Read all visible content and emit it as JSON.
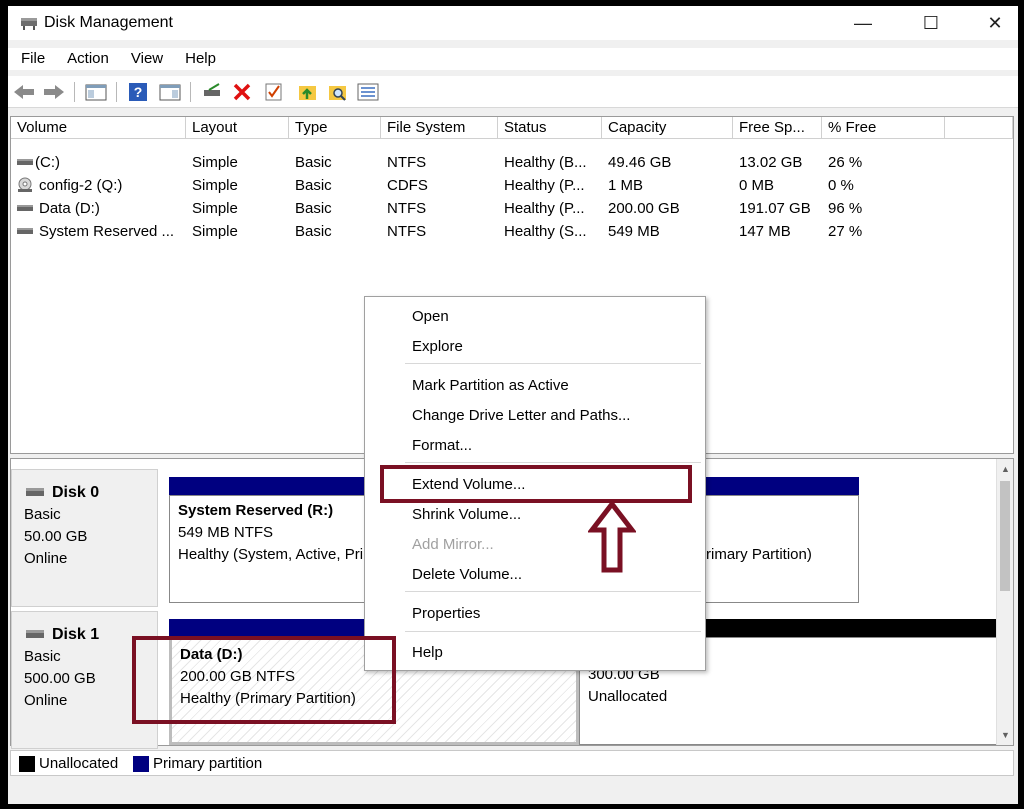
{
  "window": {
    "title": "Disk Management"
  },
  "titlebar": {
    "minimize_glyph": "—",
    "maximize_glyph": "☐",
    "close_glyph": "✕"
  },
  "menu": [
    "File",
    "Action",
    "View",
    "Help"
  ],
  "toolbar_icons": [
    "back-arrow-icon",
    "forward-arrow-icon",
    "console-tree-icon",
    "help-icon",
    "action-pane-icon",
    "connect-drive-icon",
    "delete-icon",
    "check-icon",
    "folder-up-icon",
    "folder-search-icon",
    "properties-list-icon"
  ],
  "volume_table": {
    "columns": [
      "Volume",
      "Layout",
      "Type",
      "File System",
      "Status",
      "Capacity",
      "Free Sp...",
      "% Free"
    ],
    "rows": [
      {
        "volume": " (C:)",
        "layout": "Simple",
        "type": "Basic",
        "fs": "NTFS",
        "status": "Healthy (B...",
        "capacity": "49.46 GB",
        "free": "13.02 GB",
        "pct": "26 %",
        "icon": "drive-icon"
      },
      {
        "volume": "config-2 (Q:)",
        "layout": "Simple",
        "type": "Basic",
        "fs": "CDFS",
        "status": "Healthy (P...",
        "capacity": "1 MB",
        "free": "0 MB",
        "pct": "0 %",
        "icon": "cd-drive-icon"
      },
      {
        "volume": "Data (D:)",
        "layout": "Simple",
        "type": "Basic",
        "fs": "NTFS",
        "status": "Healthy (P...",
        "capacity": "200.00 GB",
        "free": "191.07 GB",
        "pct": "96 %",
        "icon": "drive-icon"
      },
      {
        "volume": "System Reserved ...",
        "layout": "Simple",
        "type": "Basic",
        "fs": "NTFS",
        "status": "Healthy (S...",
        "capacity": "549 MB",
        "free": "147 MB",
        "pct": "27 %",
        "icon": "drive-icon"
      }
    ]
  },
  "disks": [
    {
      "name": "Disk 0",
      "type": "Basic",
      "size": "50.00 GB",
      "state": "Online",
      "partitions": [
        {
          "title": "System Reserved  (R:)",
          "size": "549 MB NTFS",
          "status": "Healthy (System, Active, Pri"
        },
        {
          "status": "rimary Partition)"
        }
      ]
    },
    {
      "name": "Disk 1",
      "type": "Basic",
      "size": "500.00 GB",
      "state": "Online",
      "partitions": [
        {
          "title": "Data  (D:)",
          "size": "200.00 GB NTFS",
          "status": "Healthy (Primary Partition)"
        },
        {
          "size": "300.00 GB",
          "status": "Unallocated"
        }
      ]
    }
  ],
  "legend": [
    {
      "label": "Unallocated",
      "color": "#000000"
    },
    {
      "label": "Primary partition",
      "color": "#000080"
    }
  ],
  "context_menu": {
    "items": [
      {
        "label": "Open",
        "enabled": true
      },
      {
        "label": "Explore",
        "enabled": true
      },
      {
        "label": "Mark Partition as Active",
        "enabled": true
      },
      {
        "label": "Change Drive Letter and Paths...",
        "enabled": true
      },
      {
        "label": "Format...",
        "enabled": true
      },
      {
        "label": "Extend Volume...",
        "enabled": true,
        "highlighted": true
      },
      {
        "label": "Shrink Volume...",
        "enabled": true
      },
      {
        "label": "Add Mirror...",
        "enabled": false
      },
      {
        "label": "Delete Volume...",
        "enabled": true
      },
      {
        "label": "Properties",
        "enabled": true
      },
      {
        "label": "Help",
        "enabled": true
      }
    ]
  },
  "colors": {
    "primary_partition": "#000080",
    "unallocated": "#000000",
    "annotation": "#7a1023",
    "window_bg": "#f0f0f0"
  }
}
